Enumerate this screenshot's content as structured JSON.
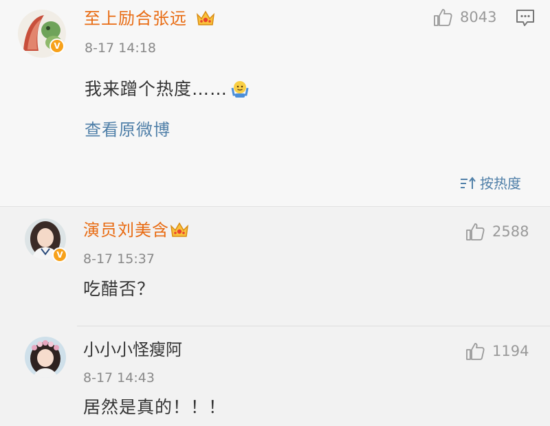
{
  "post": {
    "author": "至上励合张远",
    "time": "8-17 14:18",
    "text": "我来蹭个热度……",
    "likes": "8043",
    "view_original": "查看原微博",
    "sort_label": "按热度"
  },
  "comments": [
    {
      "author": "演员刘美含",
      "time": "8-17 15:37",
      "text": "吃醋否？",
      "likes": "2588"
    },
    {
      "author": "小小小怪瘦阿",
      "time": "8-17 14:43",
      "text": "居然是真的！！！",
      "likes": "1194"
    }
  ],
  "icons": {
    "verified": "V",
    "like": "thumbs-up-icon",
    "comment": "comment-icon",
    "crown": "crown-vip-icon",
    "sort": "sort-icon",
    "emoji": "shrug-emoji-icon"
  },
  "colors": {
    "author_orange": "#e86b12",
    "link_blue": "#4f7fa8",
    "verified_gold": "#f7a11a"
  }
}
